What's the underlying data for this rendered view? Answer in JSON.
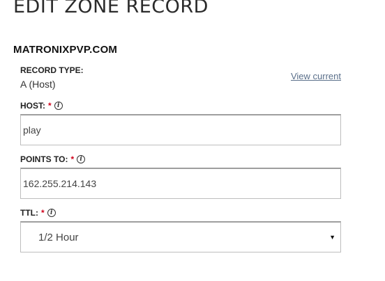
{
  "header": {
    "title": "EDIT ZONE RECORD",
    "domain": "MATRONIXPVP.COM"
  },
  "record_type": {
    "label": "RECORD TYPE:",
    "value": "A (Host)",
    "view_current_link": "View current"
  },
  "host": {
    "label": "HOST:",
    "required_mark": "*",
    "value": "play"
  },
  "points_to": {
    "label": "POINTS TO:",
    "required_mark": "*",
    "value": "162.255.214.143"
  },
  "ttl": {
    "label": "TTL:",
    "required_mark": "*",
    "selected": "1/2 Hour"
  },
  "icons": {
    "info": "i",
    "dropdown": "▼"
  },
  "colors": {
    "required": "#d0021b",
    "link": "#5a6f8a"
  }
}
